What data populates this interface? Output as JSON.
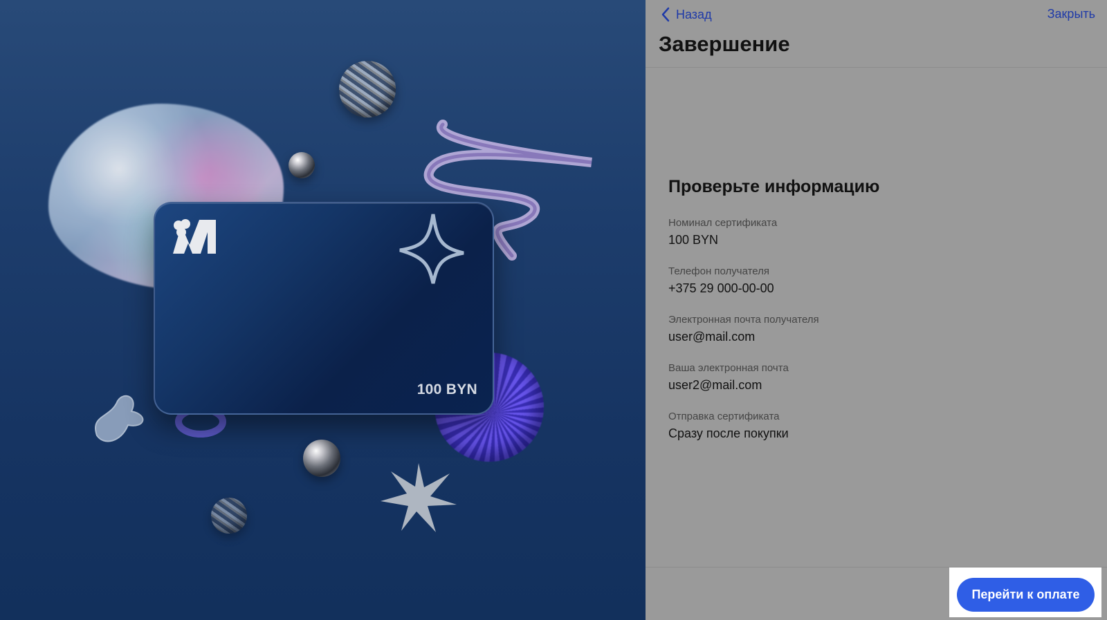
{
  "header": {
    "back_label": "Назад",
    "close_label": "Закрыть",
    "title": "Завершение"
  },
  "card": {
    "amount": "100 BYN"
  },
  "summary": {
    "title": "Проверьте информацию",
    "fields": [
      {
        "label": "Номинал сертификата",
        "value": "100 BYN"
      },
      {
        "label": "Телефон получателя",
        "value": "+375 29 000-00-00"
      },
      {
        "label": "Электронная почта получателя",
        "value": "user@mail.com"
      },
      {
        "label": "Ваша электронная почта",
        "value": "user2@mail.com"
      },
      {
        "label": "Отправка сертификата",
        "value": "Сразу после покупки"
      }
    ]
  },
  "footer": {
    "pay_label": "Перейти к оплате"
  },
  "colors": {
    "accent": "#2f5ee6",
    "link": "#1f3aa8",
    "panel_overlay": "#9a9a9a"
  }
}
